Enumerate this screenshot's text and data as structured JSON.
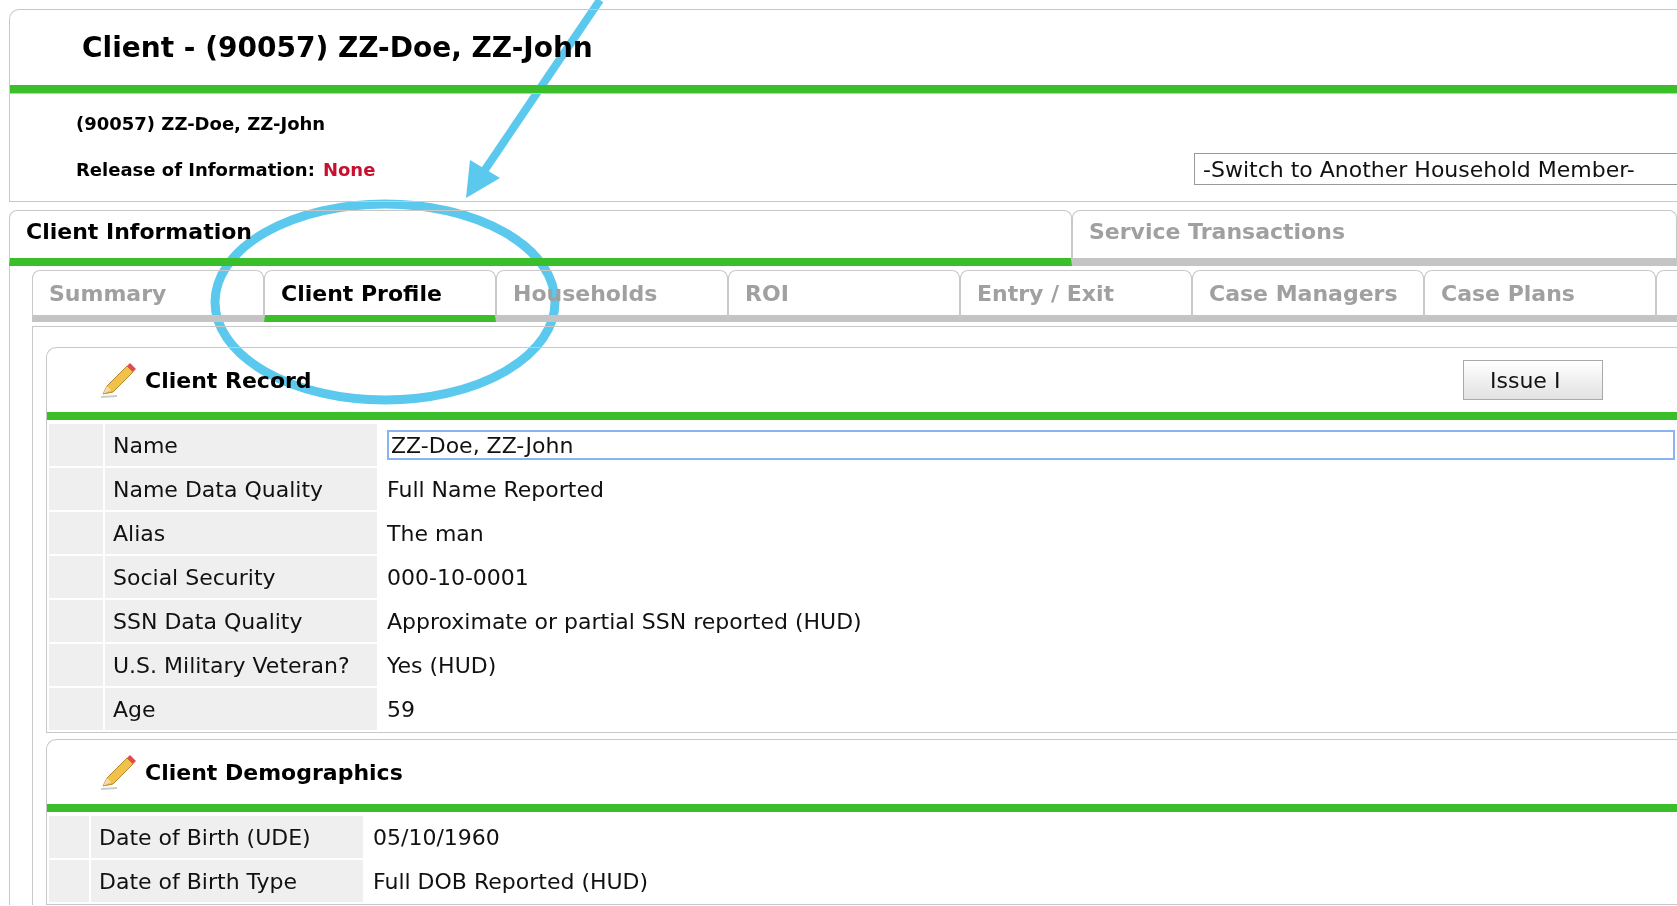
{
  "header": {
    "title": "Client - (90057) ZZ-Doe, ZZ-John"
  },
  "client_info": {
    "name": "(90057) ZZ-Doe, ZZ-John",
    "roi_label": "Release of Information:",
    "roi_value": "None",
    "household_select": "-Switch to Another Household Member-"
  },
  "main_tabs": [
    {
      "label": "Client Information",
      "selected": true
    },
    {
      "label": "Service Transactions",
      "selected": false
    }
  ],
  "sub_tabs": [
    {
      "label": "Summary",
      "selected": false
    },
    {
      "label": "Client Profile",
      "selected": true
    },
    {
      "label": "Households",
      "selected": false
    },
    {
      "label": "ROI",
      "selected": false
    },
    {
      "label": "Entry / Exit",
      "selected": false
    },
    {
      "label": "Case Managers",
      "selected": false
    },
    {
      "label": "Case Plans",
      "selected": false
    },
    {
      "selected": false
    }
  ],
  "client_record": {
    "title": "Client Record",
    "button": "Issue I",
    "rows": [
      {
        "label": "Name",
        "value": "ZZ-Doe, ZZ-John",
        "kind": "input"
      },
      {
        "label": "Name Data Quality",
        "value": "Full Name Reported",
        "kind": "text"
      },
      {
        "label": "Alias",
        "value": "The man",
        "kind": "text"
      },
      {
        "label": "Social Security",
        "value": "000-10-0001",
        "kind": "text"
      },
      {
        "label": "SSN Data Quality",
        "value": "Approximate or partial SSN reported (HUD)",
        "kind": "text"
      },
      {
        "label": "U.S. Military Veteran?",
        "value": "Yes (HUD)",
        "kind": "text"
      },
      {
        "label": "Age",
        "value": "59",
        "kind": "text"
      }
    ]
  },
  "client_demographics": {
    "title": "Client Demographics",
    "rows": [
      {
        "label": "Date of Birth (UDE)",
        "value": "05/10/1960",
        "kind": "text"
      },
      {
        "label": "Date of Birth Type",
        "value": "Full DOB Reported (HUD)",
        "kind": "text"
      }
    ]
  }
}
